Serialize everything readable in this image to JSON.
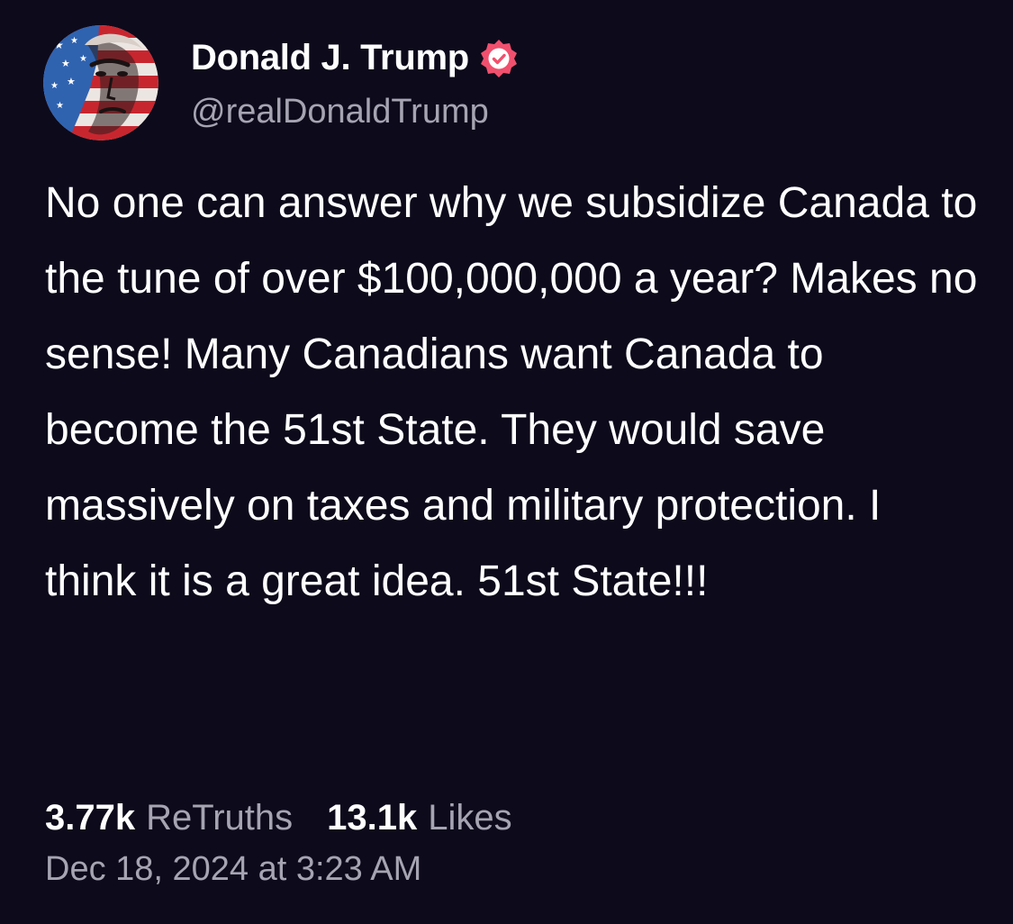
{
  "post": {
    "author": {
      "display_name": "Donald J. Trump",
      "handle": "@realDonaldTrump",
      "verified": true,
      "verified_icon": "verified-badge-icon",
      "avatar": "avatar-flag-portrait"
    },
    "text": "No one can answer why we subsidize Canada to the tune of over $100,000,000 a year? Makes no sense! Many Canadians want Canada to become the 51st State. They would save massively on taxes and military protection. I think it is a great idea. 51st State!!!",
    "stats": {
      "retruths_count": "3.77k",
      "retruths_label": "ReTruths",
      "likes_count": "13.1k",
      "likes_label": "Likes"
    },
    "timestamp": "Dec 18, 2024 at 3:23 AM"
  },
  "colors": {
    "background": "#0d0a1b",
    "primary_text": "#ffffff",
    "secondary_text": "#a6a4b3",
    "verified_badge": "#f0506e"
  }
}
